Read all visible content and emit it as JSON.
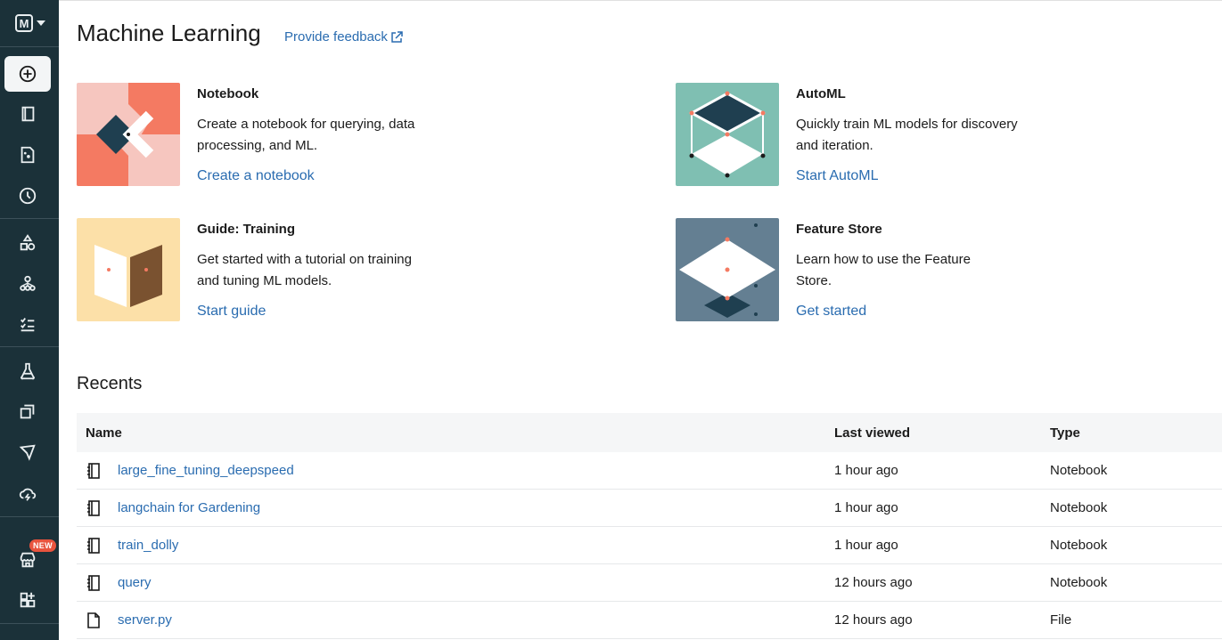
{
  "sidebar": {
    "logo_letter": "M",
    "badge": "NEW",
    "icons": [
      "new-icon",
      "workspace-icon",
      "repos-icon",
      "recents-icon",
      "catalog-icon",
      "workflows-icon",
      "compute-icon",
      "experiments-icon",
      "features-icon",
      "models-icon",
      "serving-icon",
      "marketplace-icon",
      "partner-connect-icon"
    ]
  },
  "header": {
    "title": "Machine Learning",
    "feedback": "Provide feedback"
  },
  "cards": [
    {
      "title": "Notebook",
      "desc": "Create a notebook for querying, data processing, and ML.",
      "link": "Create a notebook"
    },
    {
      "title": "AutoML",
      "desc": "Quickly train ML models for discovery and iteration.",
      "link": "Start AutoML"
    },
    {
      "title": "Guide: Training",
      "desc": "Get started with a tutorial on training and tuning ML models.",
      "link": "Start guide"
    },
    {
      "title": "Feature Store",
      "desc": "Learn how to use the Feature Store.",
      "link": "Get started"
    }
  ],
  "recents": {
    "title": "Recents",
    "columns": [
      "Name",
      "Last viewed",
      "Type"
    ],
    "rows": [
      {
        "name": "large_fine_tuning_deepspeed",
        "last": "1 hour ago",
        "type": "Notebook",
        "icon": "notebook-icon"
      },
      {
        "name": "langchain for Gardening",
        "last": "1 hour ago",
        "type": "Notebook",
        "icon": "notebook-icon"
      },
      {
        "name": "train_dolly",
        "last": "1 hour ago",
        "type": "Notebook",
        "icon": "notebook-icon"
      },
      {
        "name": "query",
        "last": "12 hours ago",
        "type": "Notebook",
        "icon": "notebook-icon"
      },
      {
        "name": "server.py",
        "last": "12 hours ago",
        "type": "File",
        "icon": "file-icon"
      }
    ]
  },
  "colors": {
    "sidebar": "#1b3139",
    "link": "#2a6cb0",
    "accent": "#e8543e"
  }
}
